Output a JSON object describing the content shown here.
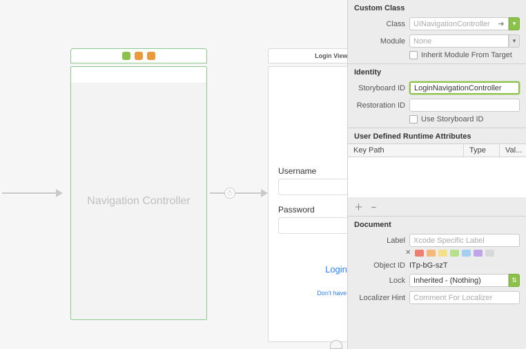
{
  "canvas": {
    "nav_controller": {
      "title": "Navigation Controller"
    },
    "login_scene": {
      "header": "Login View Co",
      "username_label": "Username",
      "password_label": "Password",
      "login_button": "Login",
      "signup_link": "Don't have an"
    }
  },
  "inspector": {
    "custom_class": {
      "header": "Custom Class",
      "class_label": "Class",
      "class_value": "UINavigationController",
      "module_label": "Module",
      "module_value": "None",
      "inherit_label": "Inherit Module From Target"
    },
    "identity": {
      "header": "Identity",
      "storyboard_id_label": "Storyboard ID",
      "storyboard_id_value": "LoginNavigationController",
      "restoration_id_label": "Restoration ID",
      "restoration_id_value": "",
      "use_storyboard_label": "Use Storyboard ID"
    },
    "udra": {
      "header": "User Defined Runtime Attributes",
      "cols": {
        "keypath": "Key Path",
        "type": "Type",
        "value": "Val..."
      },
      "ops": "＋ −"
    },
    "document": {
      "header": "Document",
      "label_label": "Label",
      "label_placeholder": "Xcode Specific Label",
      "object_id_label": "Object ID",
      "object_id_value": "ITp-bG-szT",
      "lock_label": "Lock",
      "lock_value": "Inherited - (Nothing)",
      "localizer_label": "Localizer Hint",
      "localizer_placeholder": "Comment For Localizer"
    }
  }
}
